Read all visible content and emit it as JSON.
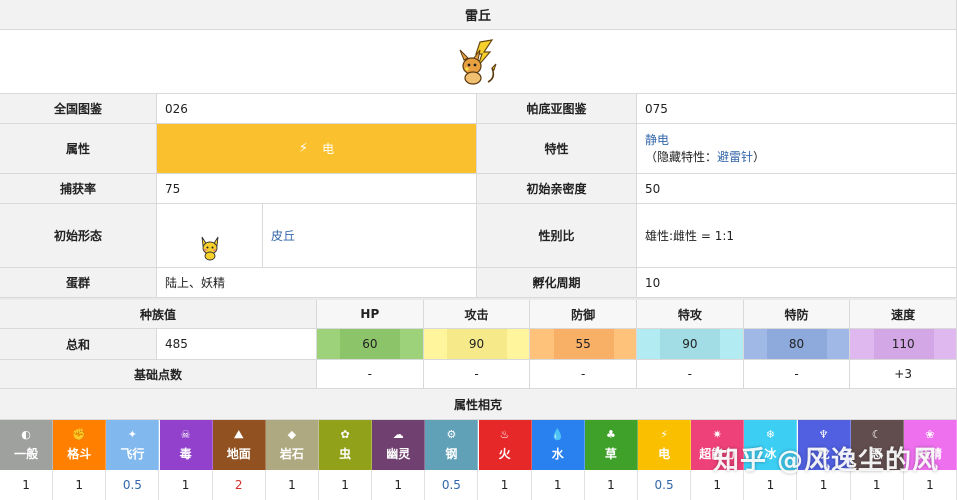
{
  "title": "雷丘",
  "info": {
    "national_dex_label": "全国图鉴",
    "national_dex_value": "026",
    "paldea_dex_label": "帕底亚图鉴",
    "paldea_dex_value": "075",
    "type_label": "属性",
    "type_value": "电",
    "ability_label": "特性",
    "ability_value": "静电",
    "hidden_ability_prefix": "（隐藏特性：",
    "hidden_ability_value": "避雷针",
    "hidden_ability_suffix": "）",
    "catch_rate_label": "捕获率",
    "catch_rate_value": "75",
    "base_friendship_label": "初始亲密度",
    "base_friendship_value": "50",
    "initial_form_label": "初始形态",
    "initial_form_value": "皮丘",
    "gender_ratio_label": "性别比",
    "gender_ratio_value": "雄性:雌性 = 1:1",
    "egg_group_label": "蛋群",
    "egg_group_value": "陆上、妖精",
    "hatch_cycle_label": "孵化周期",
    "hatch_cycle_value": "10"
  },
  "stats": {
    "section_label": "种族值",
    "total_label": "总和",
    "total_value": "485",
    "ev_label": "基础点数",
    "columns": [
      {
        "label": "HP",
        "value": "60",
        "ev": "-",
        "color": "#9dd17a",
        "dark": "#8cc46a"
      },
      {
        "label": "攻击",
        "value": "90",
        "ev": "-",
        "color": "#fff59d",
        "dark": "#f5e98a"
      },
      {
        "label": "防御",
        "value": "55",
        "ev": "-",
        "color": "#ffc27a",
        "dark": "#f7b066"
      },
      {
        "label": "特攻",
        "value": "90",
        "ev": "-",
        "color": "#b2ebf2",
        "dark": "#a2dde5"
      },
      {
        "label": "特防",
        "value": "80",
        "ev": "-",
        "color": "#9fb8e6",
        "dark": "#8ea9db"
      },
      {
        "label": "速度",
        "value": "110",
        "ev": "+3",
        "color": "#e0b8f0",
        "dark": "#d3a6e6"
      }
    ]
  },
  "matchups": {
    "section_label": "属性相克",
    "types": [
      {
        "name": "一般",
        "icon": "◐",
        "color": "#9fa19f",
        "mult": "1"
      },
      {
        "name": "格斗",
        "icon": "✊",
        "color": "#ff8000",
        "mult": "1"
      },
      {
        "name": "飞行",
        "icon": "✦",
        "color": "#81b9ef",
        "mult": "0.5"
      },
      {
        "name": "毒",
        "icon": "☠",
        "color": "#9141cb",
        "mult": "1"
      },
      {
        "name": "地面",
        "icon": "⛰",
        "color": "#915121",
        "mult": "2"
      },
      {
        "name": "岩石",
        "icon": "◆",
        "color": "#afa981",
        "mult": "1"
      },
      {
        "name": "虫",
        "icon": "✿",
        "color": "#91a119",
        "mult": "1"
      },
      {
        "name": "幽灵",
        "icon": "☁",
        "color": "#704170",
        "mult": "1"
      },
      {
        "name": "钢",
        "icon": "⚙",
        "color": "#60a1b8",
        "mult": "0.5"
      },
      {
        "name": "火",
        "icon": "♨",
        "color": "#e62829",
        "mult": "1"
      },
      {
        "name": "水",
        "icon": "💧",
        "color": "#2980ef",
        "mult": "1"
      },
      {
        "name": "草",
        "icon": "♣",
        "color": "#3fa129",
        "mult": "1"
      },
      {
        "name": "电",
        "icon": "⚡",
        "color": "#fac000",
        "mult": "0.5"
      },
      {
        "name": "超能力",
        "icon": "✷",
        "color": "#ef4179",
        "mult": "1"
      },
      {
        "name": "冰",
        "icon": "❄",
        "color": "#3dcef3",
        "mult": "1"
      },
      {
        "name": "龙",
        "icon": "♆",
        "color": "#5060e1",
        "mult": "1"
      },
      {
        "name": "恶",
        "icon": "☾",
        "color": "#624d4e",
        "mult": "1"
      },
      {
        "name": "妖精",
        "icon": "❀",
        "color": "#ef70ef",
        "mult": "1"
      }
    ]
  },
  "watermark": "知乎 @风逸尘的风",
  "colors": {
    "electric": "#fbc02d",
    "weak": "#d32f2f",
    "resist": "#3366aa"
  }
}
